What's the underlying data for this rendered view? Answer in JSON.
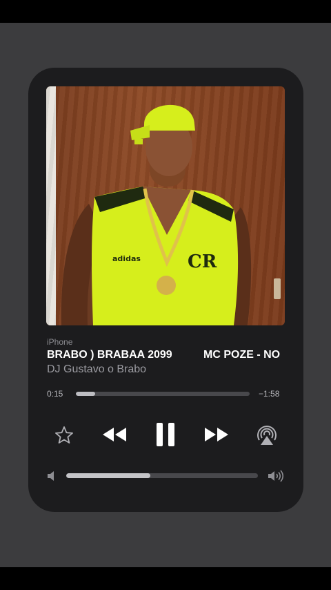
{
  "player": {
    "source": "iPhone",
    "title_part1": "BRABO ) BRABAA 2099",
    "title_part2": "MC POZE - NO",
    "artist": "DJ Gustavo o Brabo",
    "elapsed": "0:15",
    "remaining": "−1:58",
    "progress_fraction": 0.11,
    "volume_fraction": 0.44
  },
  "icons": {
    "favorite": "star-icon",
    "previous": "rewind-icon",
    "play_pause": "pause-icon",
    "next": "fast-forward-icon",
    "output": "airplay-icon",
    "volume_min": "speaker-low-icon",
    "volume_max": "speaker-high-icon"
  },
  "colors": {
    "card": "#1c1c1e",
    "backdrop": "#3c3c3e",
    "text_primary": "#ffffff",
    "text_secondary": "#9b9ba1",
    "track": "#48484c",
    "fill": "#bdbdc2"
  }
}
